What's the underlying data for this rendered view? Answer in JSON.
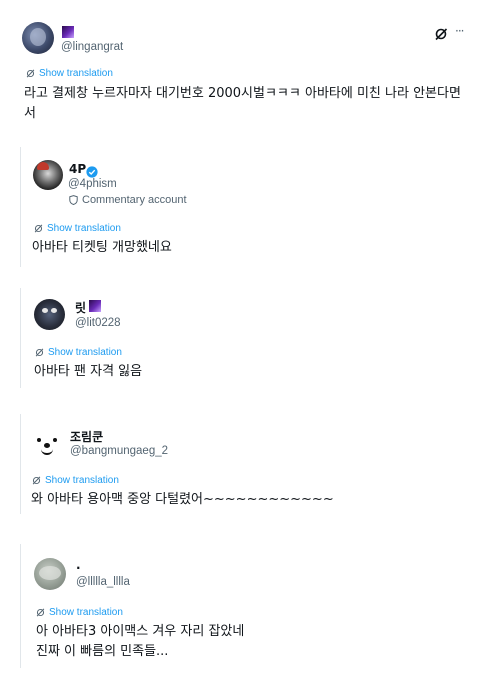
{
  "top_tweet": {
    "handle": "@lingangrat",
    "translate_label": "Show translation",
    "text_line1": "라고 결제창 누르자마자 대기번호 2000시벌ㅋㅋㅋ 아바타에 미친 나라 안본다면",
    "text_line2": "서",
    "actions": {
      "grok_icon": "grok-icon",
      "more_icon": "more-icon",
      "more_label": "···"
    }
  },
  "replies": [
    {
      "name": "4P",
      "handle": "@4phism",
      "account_label": "Commentary account",
      "translate_label": "Show translation",
      "text": "아바타 티켓팅 개망했네요"
    },
    {
      "name": "릿",
      "handle": "@lit0228",
      "translate_label": "Show translation",
      "text": "아바타 팬 자격 잃음"
    },
    {
      "name": "조림쿤",
      "handle": "@bangmungaeg_2",
      "translate_label": "Show translation",
      "text": "와 아바타 용아맥 중앙 다털렸어~~~~~~~~~~~~"
    },
    {
      "name": ".",
      "handle": "@llllla_lllla",
      "translate_label": "Show translation",
      "text_line1": "아 아바타3 아이맥스 겨우 자리 잡았네",
      "text_line2": "진짜 이 빠름의 민족들..."
    }
  ],
  "colors": {
    "link": "#1d9bf0",
    "secondary": "#536471",
    "verified": "#1d9bf0",
    "card_border": "#e1e6ea"
  }
}
